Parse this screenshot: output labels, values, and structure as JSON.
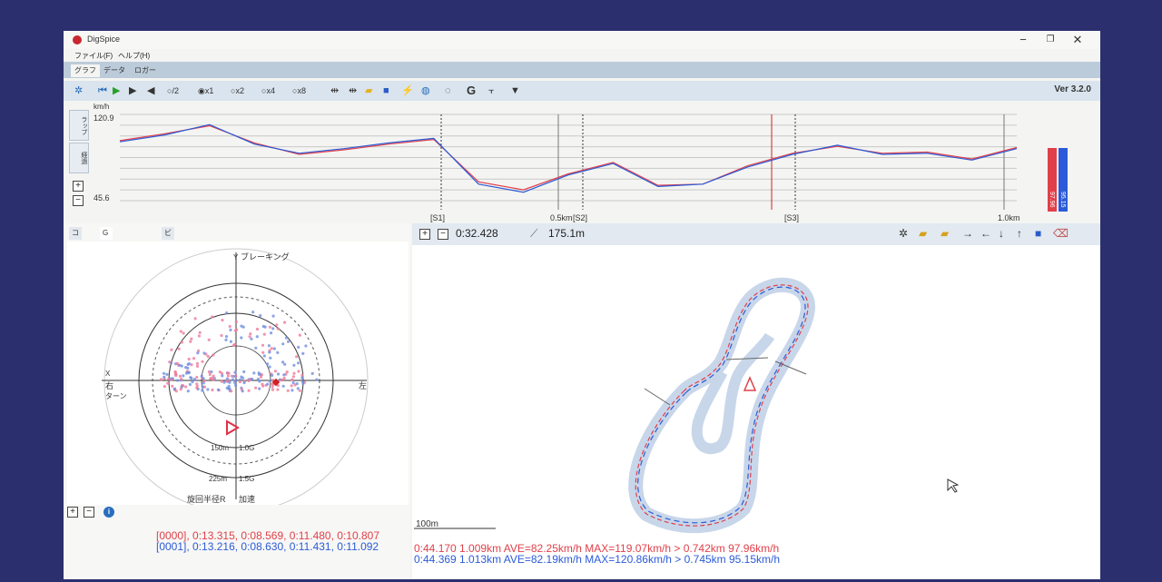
{
  "window": {
    "title": "DigSpice"
  },
  "menu": [
    "ファイル(F)",
    "ヘルプ(H)"
  ],
  "main_tabs": [
    "グラフ",
    "データ",
    "ロガー"
  ],
  "toolbar": {
    "speed_options": [
      "/2",
      "x1",
      "x2",
      "x4",
      "x8"
    ],
    "selected_speed": "x1",
    "g_label": "G",
    "version": "Ver 3.2.0"
  },
  "speed_chart": {
    "unit": "km/h",
    "y_max": "120.9",
    "y_min": "45.6",
    "side_tabs": [
      "ラップ",
      "経過"
    ],
    "markers": [
      "[S1]",
      "0.5km",
      "[S2]",
      "[S3]",
      "1.0km"
    ],
    "legend_red": "97.96",
    "legend_blue": "95.15"
  },
  "chart_data": {
    "type": "line",
    "ylim": [
      45.6,
      120.9
    ],
    "x": [
      0,
      0.05,
      0.1,
      0.15,
      0.2,
      0.25,
      0.3,
      0.35,
      0.4,
      0.45,
      0.5,
      0.55,
      0.6,
      0.65,
      0.7,
      0.75,
      0.8,
      0.85,
      0.9,
      0.95,
      1.0
    ],
    "series": [
      {
        "color": "#e0404a",
        "values": [
          98,
          104,
          111,
          96,
          86,
          90,
          95,
          99,
          62,
          55,
          69,
          79,
          59,
          60,
          76,
          87,
          93,
          87,
          88,
          82,
          92
        ]
      },
      {
        "color": "#2b5bd8",
        "values": [
          97,
          103,
          112,
          95,
          87,
          91,
          96,
          100,
          60,
          53,
          68,
          78,
          58,
          60,
          75,
          86,
          94,
          86,
          87,
          81,
          91
        ]
      }
    ]
  },
  "g_panel": {
    "tabs": [
      "コース",
      "G / 旋回半径",
      "ビデオ"
    ],
    "top_label": "ブレーキング",
    "left_label": "右",
    "left_sub": "ターン",
    "right_label": "左",
    "ring1": "150m",
    "ring1_g": "1.0G",
    "ring2": "225m",
    "ring2_g": "1.5G",
    "bottom_left": "旋回半径R",
    "bottom_right": "加速",
    "x_axis": "X",
    "y_axis": "Y"
  },
  "sector_lines": [
    {
      "color": "#e0404a",
      "text": "[0000], 0:13.315, 0:08.569, 0:11.480, 0:10.807"
    },
    {
      "color": "#2b5bd8",
      "text": "[0001], 0:13.216, 0:08.630, 0:11.431, 0:11.092"
    }
  ],
  "map_panel": {
    "time": "0:32.428",
    "distance": "175.1m",
    "scale": "100m"
  },
  "lap_lines": [
    {
      "color": "#e0404a",
      "text": "0:44.170 1.009km AVE=82.25km/h MAX=119.07km/h > 0.742km 97.96km/h"
    },
    {
      "color": "#2b5bd8",
      "text": "0:44.369 1.013km AVE=82.19km/h MAX=120.86km/h > 0.745km 95.15km/h"
    }
  ]
}
